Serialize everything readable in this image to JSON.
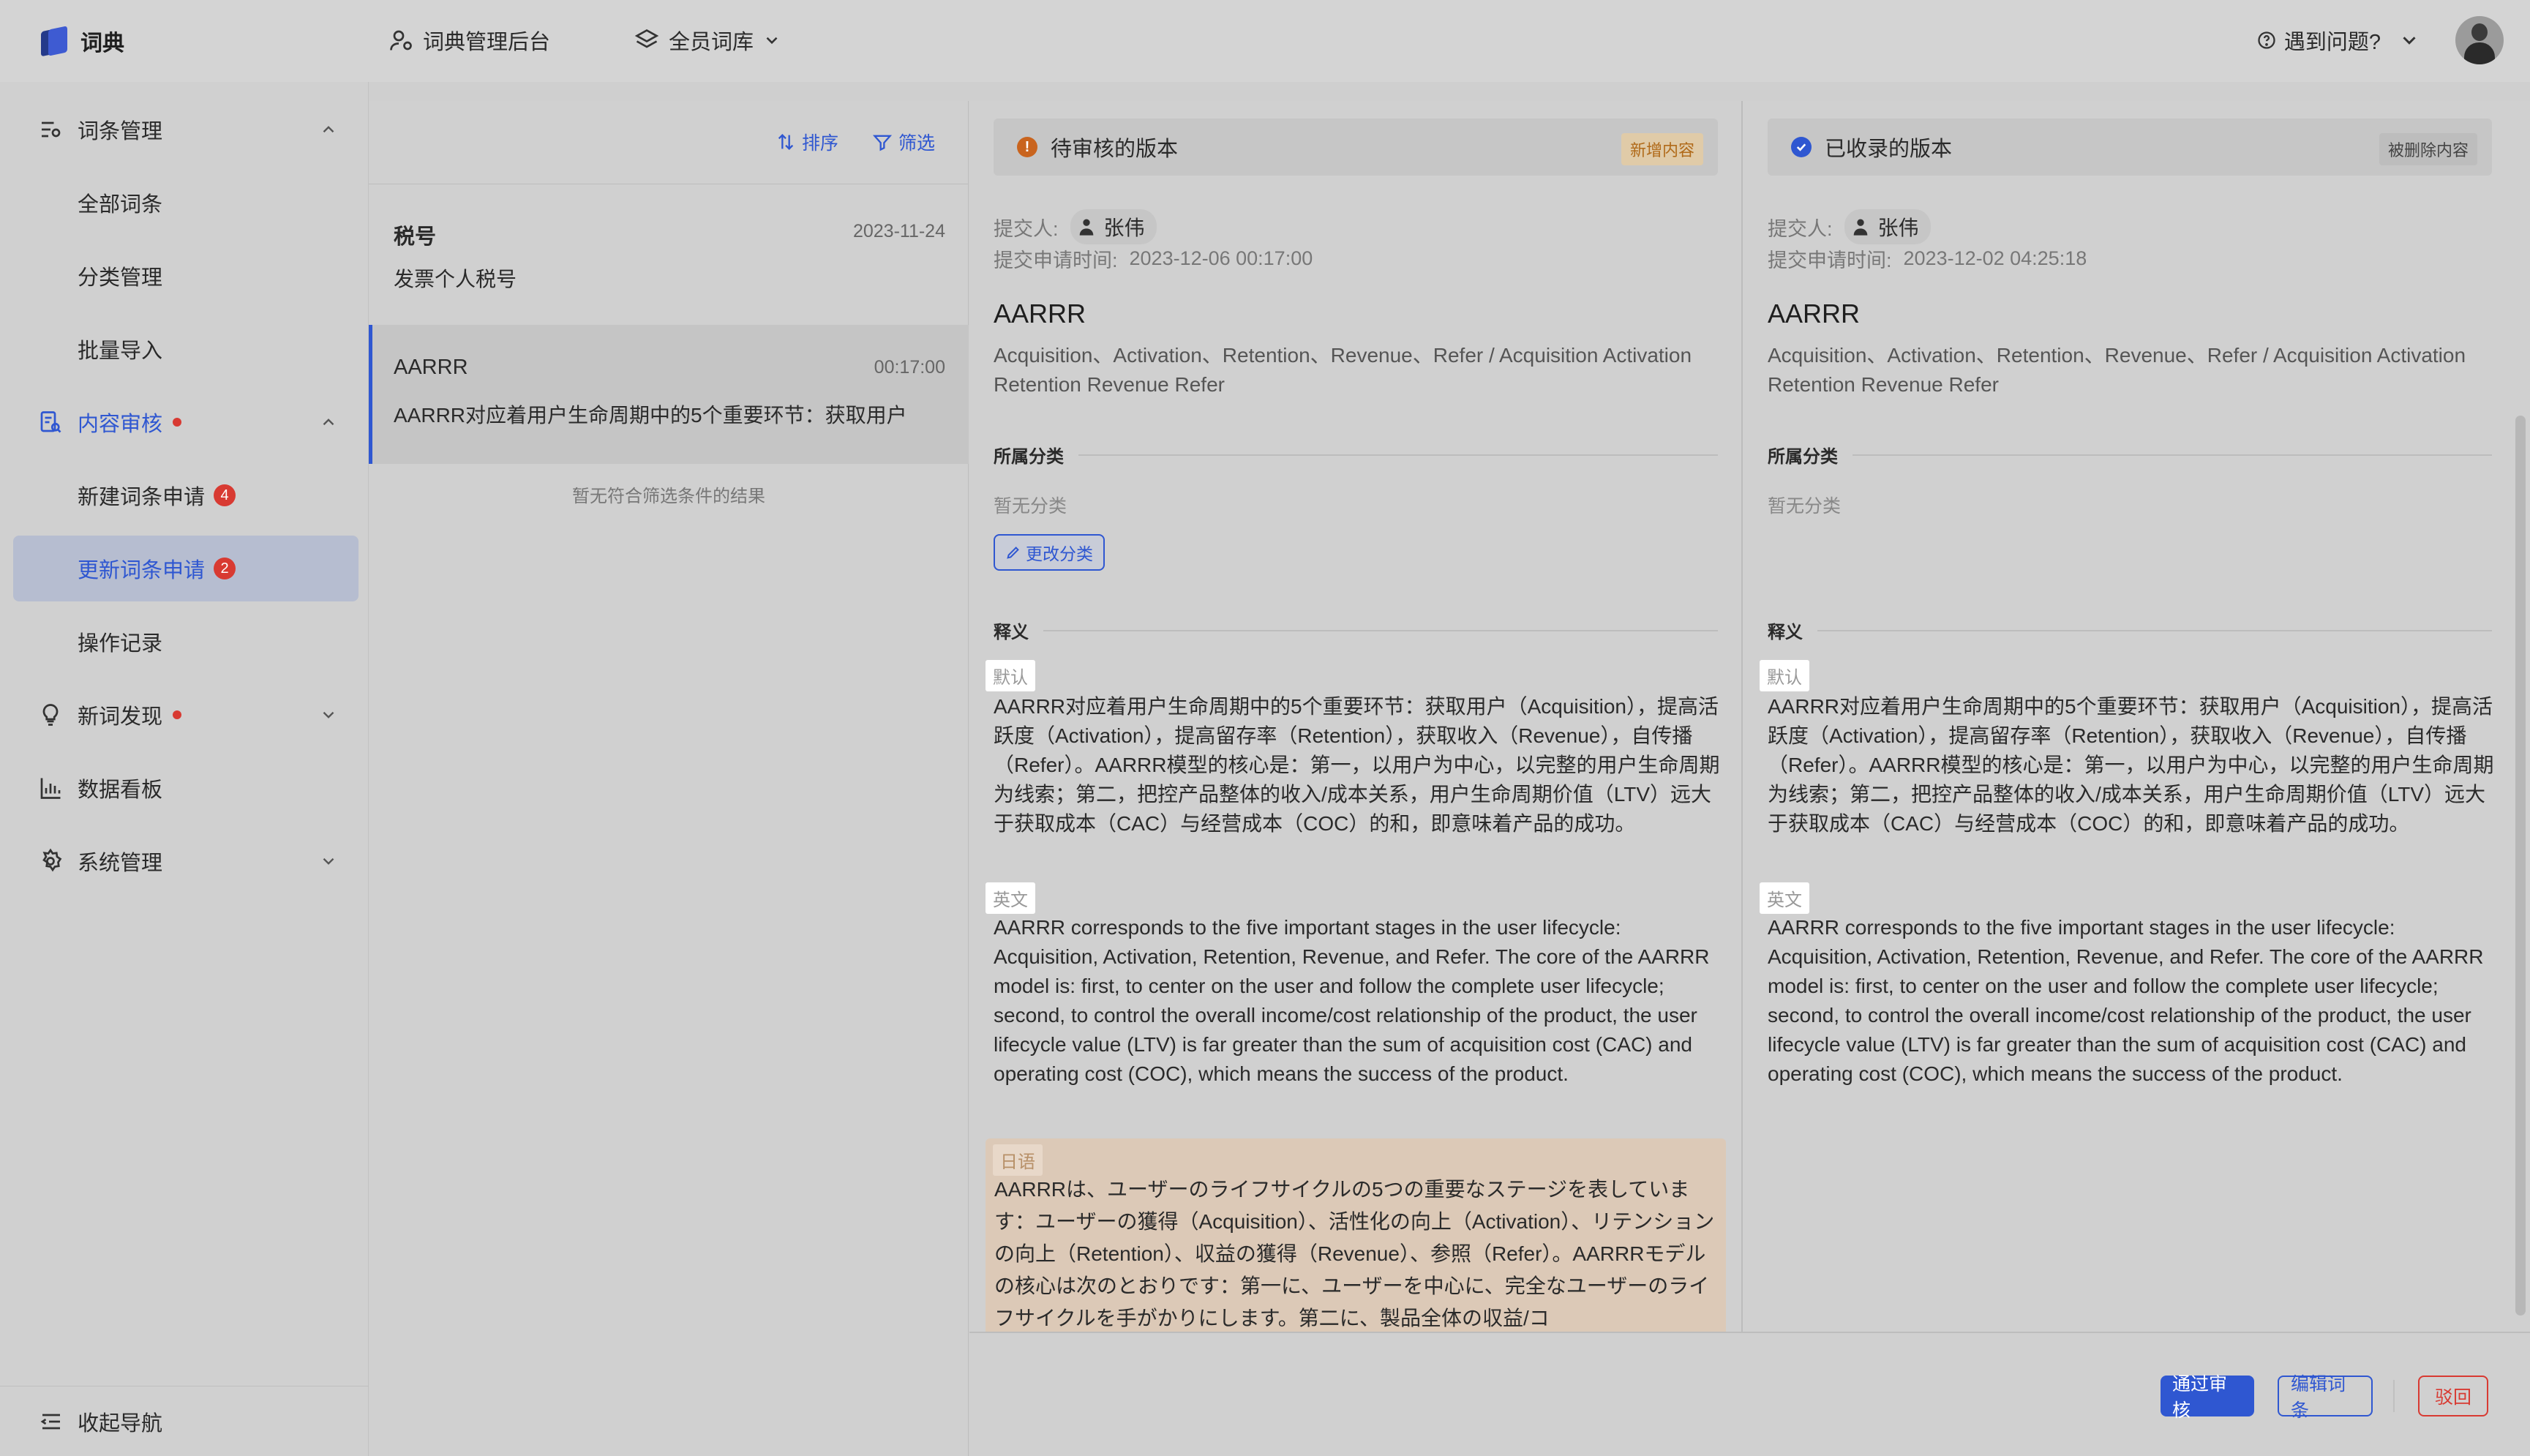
{
  "app": {
    "title": "词典"
  },
  "header": {
    "admin_label": "词典管理后台",
    "library_label": "全员词库",
    "help_label": "遇到问题?"
  },
  "sidebar": {
    "groups": [
      {
        "label": "词条管理",
        "items": [
          "全部词条",
          "分类管理",
          "批量导入"
        ]
      },
      {
        "label": "内容审核",
        "items": [
          {
            "label": "新建词条申请",
            "count": "4"
          },
          {
            "label": "更新词条申请",
            "count": "2"
          },
          {
            "label": "操作记录"
          }
        ]
      },
      {
        "label": "新词发现"
      },
      {
        "label": "数据看板"
      },
      {
        "label": "系统管理"
      }
    ],
    "collapse_label": "收起导航"
  },
  "list": {
    "sort_label": "排序",
    "filter_label": "筛选",
    "items": [
      {
        "title": "税号",
        "date": "2023-11-24",
        "subtitle": "发票个人税号"
      },
      {
        "title": "AARRR",
        "date": "00:17:00",
        "subtitle": "AARRR对应着用户生命周期中的5个重要环节：获取用户"
      }
    ],
    "empty_note": "暂无符合筛选条件的结果"
  },
  "pending": {
    "header": "待审核的版本",
    "tag": "新增内容",
    "submitter_label": "提交人:",
    "submitter": "张伟",
    "time_label": "提交申请时间:",
    "time": "2023-12-06 00:17:00",
    "term": "AARRR",
    "abbr": "Acquisition、Activation、Retention、Revenue、Refer / Acquisition Activation Retention Revenue Refer",
    "category_title": "所属分类",
    "no_category": "暂无分类",
    "change_category": "更改分类",
    "definition_title": "释义",
    "default_label": "默认",
    "default_text": "AARRR对应着用户生命周期中的5个重要环节：获取用户（Acquisition），提高活跃度（Activation），提高留存率（Retention），获取收入（Revenue），自传播（Refer）。AARRR模型的核心是：第一，以用户为中心，以完整的用户生命周期为线索；第二，把控产品整体的收入/成本关系，用户生命周期价值（LTV）远大于获取成本（CAC）与经营成本（COC）的和，即意味着产品的成功。",
    "en_label": "英文",
    "en_text": "AARRR corresponds to the five important stages in the user lifecycle: Acquisition, Activation, Retention, Revenue, and Refer. The core of the AARRR model is: first, to center on the user and follow the complete user lifecycle; second, to control the overall income/cost relationship of the product, the user lifecycle value (LTV) is far greater than the sum of acquisition cost (CAC) and operating cost (COC), which means the success of the product.",
    "jp_label": "日语",
    "jp_text": "AARRRは、ユーザーのライフサイクルの5つの重要なステージを表しています：ユーザーの獲得（Acquisition）、活性化の向上（Activation）、リテンションの向上（Retention）、収益の獲得（Revenue）、参照（Refer）。AARRRモデルの核心は次のとおりです：第一に、ユーザーを中心に、完全なユーザーのライフサイクルを手がかりにします。第二に、製品全体の収益/コ"
  },
  "recorded": {
    "header": "已收录的版本",
    "tag": "被删除内容",
    "submitter_label": "提交人:",
    "submitter": "张伟",
    "time_label": "提交申请时间:",
    "time": "2023-12-02 04:25:18",
    "term": "AARRR",
    "abbr": "Acquisition、Activation、Retention、Revenue、Refer / Acquisition Activation Retention Revenue Refer",
    "category_title": "所属分类",
    "no_category": "暂无分类",
    "definition_title": "释义",
    "default_label": "默认",
    "default_text": "AARRR对应着用户生命周期中的5个重要环节：获取用户（Acquisition），提高活跃度（Activation），提高留存率（Retention），获取收入（Revenue），自传播（Refer）。AARRR模型的核心是：第一，以用户为中心，以完整的用户生命周期为线索；第二，把控产品整体的收入/成本关系，用户生命周期价值（LTV）远大于获取成本（CAC）与经营成本（COC）的和，即意味着产品的成功。",
    "en_label": "英文",
    "en_text": "AARRR corresponds to the five important stages in the user lifecycle: Acquisition, Activation, Retention, Revenue, and Refer. The core of the AARRR model is: first, to center on the user and follow the complete user lifecycle; second, to control the overall income/cost relationship of the product, the user lifecycle value (LTV) is far greater than the sum of acquisition cost (CAC) and operating cost (COC), which means the success of the product."
  },
  "actions": {
    "approve": "通过审核",
    "edit": "编辑词条",
    "reject": "驳回"
  },
  "colors": {
    "accent": "#2f57d1",
    "danger": "#d83a32",
    "warning": "#b06a19"
  }
}
